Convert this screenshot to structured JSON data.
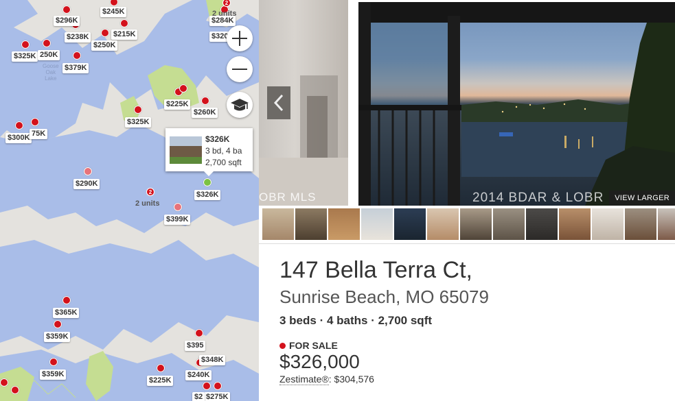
{
  "map": {
    "controls": {
      "zoom_in_icon": "plus-icon",
      "zoom_out_icon": "minus-icon",
      "schools_icon": "graduation-cap-icon"
    },
    "water_labels": [
      "Goose",
      "Oak",
      "Lake"
    ],
    "price_labels": [
      "$296K",
      "$245K",
      "$284K",
      "$238K",
      "$215K",
      "$250K",
      "$320",
      "$325K",
      "250K",
      "$379K",
      "$225K",
      "$260K",
      "$325K",
      "$300K",
      "75K",
      "$290K",
      "$326K",
      "$399K",
      "$365K",
      "$359K",
      "$395",
      "$348K",
      "$359K",
      "$225K",
      "$240K",
      "$275K",
      "$2"
    ],
    "unit_labels": [
      "2 units",
      "2 units"
    ],
    "cluster_counts": [
      "2",
      "2"
    ],
    "popup": {
      "price": "$326K",
      "beds_baths": "3 bd, 4 ba",
      "sqft": "2,700 sqft"
    }
  },
  "photos": {
    "prev_watermark": "OBR MLS",
    "main_watermark": "2014 BDAR & LOBR",
    "view_larger": "VIEW LARGER",
    "prev_icon": "chevron-left-icon",
    "thumbnail_count": 13
  },
  "listing": {
    "address_line1": "147 Bella Terra Ct,",
    "address_line2": "Sunrise Beach, MO 65079",
    "facts": "3 beds · 4 baths · 2,700 sqft",
    "status": "FOR SALE",
    "price": "$326,000",
    "zestimate_label": "Zestimate®",
    "zestimate_value": ": $304,576",
    "status_color": "#d3121c"
  }
}
